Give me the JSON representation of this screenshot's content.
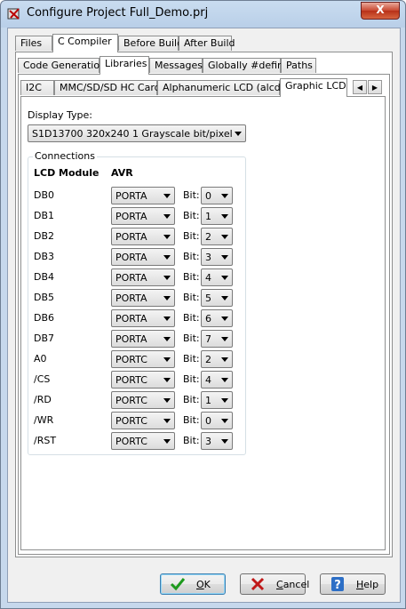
{
  "window": {
    "title": "Configure Project Full_Demo.prj",
    "close_glyph": "X"
  },
  "tabs_main": [
    "Files",
    "C Compiler",
    "Before Build",
    "After Build"
  ],
  "tabs_compiler": [
    "Code Generation",
    "Libraries",
    "Messages",
    "Globally #define",
    "Paths"
  ],
  "tabs_libraries": [
    "I2C",
    "MMC/SD/SD HC Card",
    "Alphanumeric LCD (alcd.h)",
    "Graphic LCD"
  ],
  "display_type": {
    "label": "Display Type:",
    "value": "S1D13700 320x240 1 Grayscale bit/pixel"
  },
  "connections": {
    "title": "Connections",
    "col_module": "LCD Module",
    "col_avr": "AVR",
    "bit_label": "Bit:",
    "rows": [
      {
        "module": "DB0",
        "port": "PORTA",
        "bit": "0"
      },
      {
        "module": "DB1",
        "port": "PORTA",
        "bit": "1"
      },
      {
        "module": "DB2",
        "port": "PORTA",
        "bit": "2"
      },
      {
        "module": "DB3",
        "port": "PORTA",
        "bit": "3"
      },
      {
        "module": "DB4",
        "port": "PORTA",
        "bit": "4"
      },
      {
        "module": "DB5",
        "port": "PORTA",
        "bit": "5"
      },
      {
        "module": "DB6",
        "port": "PORTA",
        "bit": "6"
      },
      {
        "module": "DB7",
        "port": "PORTA",
        "bit": "7"
      },
      {
        "module": "A0",
        "port": "PORTC",
        "bit": "2"
      },
      {
        "module": "/CS",
        "port": "PORTC",
        "bit": "4"
      },
      {
        "module": "/RD",
        "port": "PORTC",
        "bit": "1"
      },
      {
        "module": "/WR",
        "port": "PORTC",
        "bit": "0"
      },
      {
        "module": "/RST",
        "port": "PORTC",
        "bit": "3"
      }
    ]
  },
  "buttons": {
    "ok": {
      "accel": "O",
      "rest": "K"
    },
    "cancel": {
      "accel": "C",
      "rest": "ancel"
    },
    "help": {
      "accel": "H",
      "rest": "elp"
    }
  }
}
